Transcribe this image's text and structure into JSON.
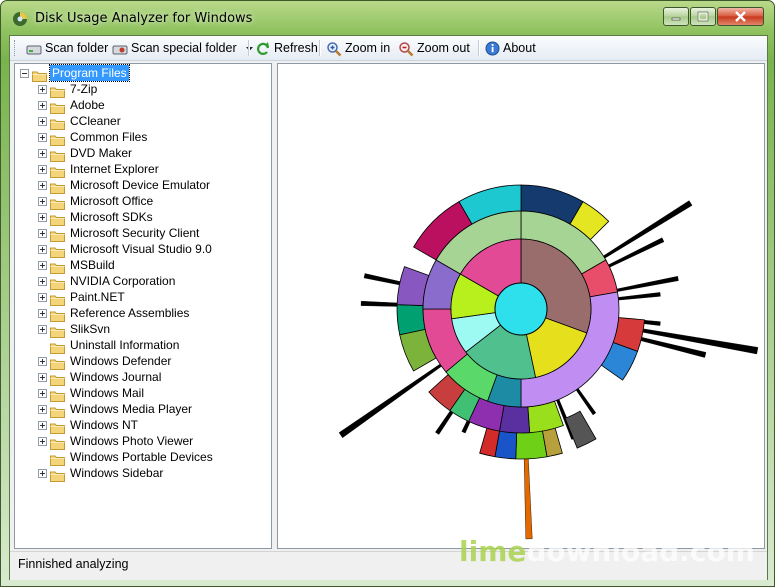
{
  "window": {
    "title": "Disk Usage Analyzer for Windows"
  },
  "toolbar": {
    "scan_folder": "Scan folder",
    "scan_special": "Scan special folder",
    "refresh": "Refresh",
    "zoom_in": "Zoom in",
    "zoom_out": "Zoom out",
    "about": "About"
  },
  "tree": {
    "root": "Program Files",
    "items": [
      {
        "label": "7-Zip",
        "expandable": true
      },
      {
        "label": "Adobe",
        "expandable": true
      },
      {
        "label": "CCleaner",
        "expandable": true
      },
      {
        "label": "Common Files",
        "expandable": true
      },
      {
        "label": "DVD Maker",
        "expandable": true
      },
      {
        "label": "Internet Explorer",
        "expandable": true
      },
      {
        "label": "Microsoft Device Emulator",
        "expandable": true
      },
      {
        "label": "Microsoft Office",
        "expandable": true
      },
      {
        "label": "Microsoft SDKs",
        "expandable": true
      },
      {
        "label": "Microsoft Security Client",
        "expandable": true
      },
      {
        "label": "Microsoft Visual Studio 9.0",
        "expandable": true
      },
      {
        "label": "MSBuild",
        "expandable": true
      },
      {
        "label": "NVIDIA Corporation",
        "expandable": true
      },
      {
        "label": "Paint.NET",
        "expandable": true
      },
      {
        "label": "Reference Assemblies",
        "expandable": true
      },
      {
        "label": "SlikSvn",
        "expandable": true
      },
      {
        "label": "Uninstall Information",
        "expandable": false
      },
      {
        "label": "Windows Defender",
        "expandable": true
      },
      {
        "label": "Windows Journal",
        "expandable": true
      },
      {
        "label": "Windows Mail",
        "expandable": true
      },
      {
        "label": "Windows Media Player",
        "expandable": true
      },
      {
        "label": "Windows NT",
        "expandable": true
      },
      {
        "label": "Windows Photo Viewer",
        "expandable": true
      },
      {
        "label": "Windows Portable Devices",
        "expandable": false
      },
      {
        "label": "Windows Sidebar",
        "expandable": true
      }
    ]
  },
  "status": {
    "text": "Finnished analyzing"
  },
  "watermark": {
    "part1": "lime",
    "part2": "download.com"
  },
  "sunburst": {
    "center_color": "#2ee0ec",
    "ring1": [
      {
        "start": 0,
        "end": 110,
        "color": "#9a6d6d"
      },
      {
        "start": 110,
        "end": 168,
        "color": "#e6df1c"
      },
      {
        "start": 168,
        "end": 232,
        "color": "#4fc08e"
      },
      {
        "start": 232,
        "end": 262,
        "color": "#9dfaf2"
      },
      {
        "start": 262,
        "end": 300,
        "color": "#b8f01d"
      },
      {
        "start": 300,
        "end": 360,
        "color": "#e24a96"
      }
    ],
    "ring2": [
      {
        "start": 0,
        "end": 60,
        "color": "#a6d494"
      },
      {
        "start": 60,
        "end": 80,
        "color": "#e84e6a"
      },
      {
        "start": 80,
        "end": 180,
        "color": "#c08ef2"
      },
      {
        "start": 180,
        "end": 200,
        "color": "#1c8ba3"
      },
      {
        "start": 200,
        "end": 230,
        "color": "#5bd86a"
      },
      {
        "start": 230,
        "end": 270,
        "color": "#e24a96"
      },
      {
        "start": 270,
        "end": 300,
        "color": "#8a6ccc"
      },
      {
        "start": 300,
        "end": 360,
        "color": "#a6d494"
      }
    ],
    "ring3": [
      {
        "start": 0,
        "end": 30,
        "color": "#143a6e"
      },
      {
        "start": 30,
        "end": 45,
        "color": "#e3e621"
      },
      {
        "start": 95,
        "end": 110,
        "color": "#d63a3a"
      },
      {
        "start": 110,
        "end": 125,
        "color": "#2b86d8"
      },
      {
        "start": 160,
        "end": 176,
        "color": "#9adf1c"
      },
      {
        "start": 176,
        "end": 190,
        "color": "#5a2fa0"
      },
      {
        "start": 190,
        "end": 205,
        "color": "#8e2fb0"
      },
      {
        "start": 205,
        "end": 215,
        "color": "#3fc072"
      },
      {
        "start": 215,
        "end": 228,
        "color": "#c83e3e"
      },
      {
        "start": 240,
        "end": 258,
        "color": "#7cb33b"
      },
      {
        "start": 258,
        "end": 272,
        "color": "#00a070"
      },
      {
        "start": 272,
        "end": 290,
        "color": "#8858c0"
      },
      {
        "start": 300,
        "end": 330,
        "color": "#bb1060"
      },
      {
        "start": 330,
        "end": 360,
        "color": "#1ec8d0"
      }
    ],
    "ring4": [
      {
        "start": 170,
        "end": 182,
        "color": "#6fd018"
      },
      {
        "start": 182,
        "end": 190,
        "color": "#1a54c9"
      },
      {
        "start": 190,
        "end": 196,
        "color": "#d32a2a"
      },
      {
        "start": 164,
        "end": 170,
        "color": "#b8a13d"
      },
      {
        "start": 150,
        "end": 158,
        "color": "#555555"
      }
    ],
    "spikes": [
      {
        "angle": 58,
        "length": 200,
        "color": "#000000"
      },
      {
        "angle": 64,
        "length": 158,
        "color": "#000000"
      },
      {
        "angle": 100,
        "length": 240,
        "color": "#000000"
      },
      {
        "angle": 104,
        "length": 190,
        "color": "#000000"
      },
      {
        "angle": 96,
        "length": 140,
        "color": "#000000"
      },
      {
        "angle": 145,
        "length": 128,
        "color": "#000000"
      },
      {
        "angle": 158,
        "length": 140,
        "color": "#000000"
      },
      {
        "angle": 178,
        "length": 230,
        "color": "#e46a00"
      },
      {
        "angle": 205,
        "length": 136,
        "color": "#000000"
      },
      {
        "angle": 214,
        "length": 150,
        "color": "#000000"
      },
      {
        "angle": 235,
        "length": 220,
        "color": "#000000"
      },
      {
        "angle": 272,
        "length": 160,
        "color": "#000000"
      },
      {
        "angle": 282,
        "length": 160,
        "color": "#000000"
      },
      {
        "angle": 79,
        "length": 160,
        "color": "#000000"
      },
      {
        "angle": 84,
        "length": 140,
        "color": "#000000"
      }
    ]
  }
}
